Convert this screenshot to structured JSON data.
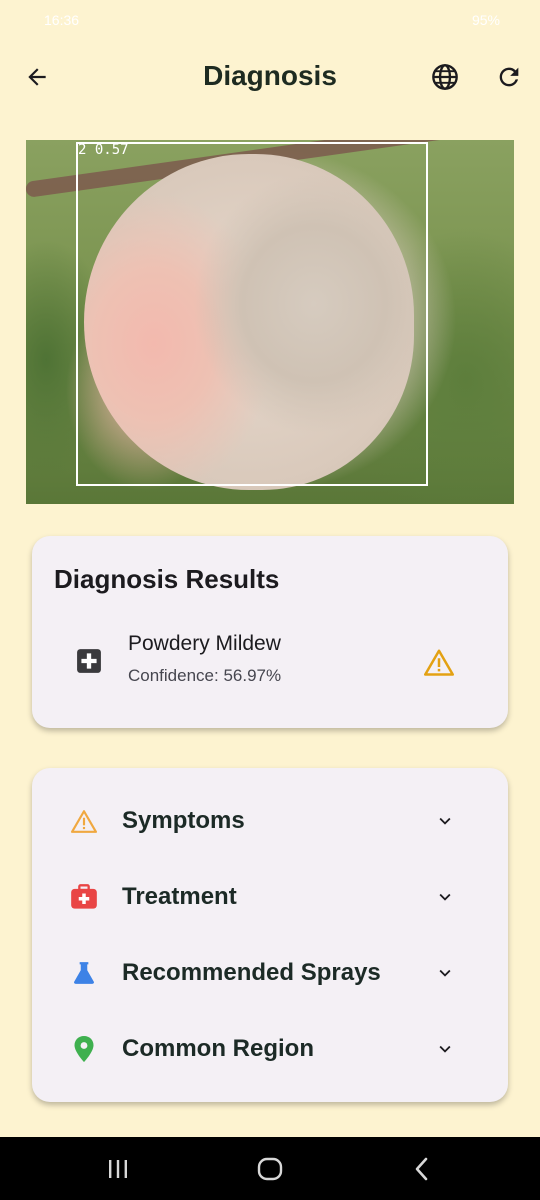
{
  "status_bar": {
    "time": "16:36",
    "battery": "95%"
  },
  "app_bar": {
    "title": "Diagnosis",
    "back_icon": "arrow-left-icon",
    "language_icon": "globe-icon",
    "refresh_icon": "refresh-icon"
  },
  "photo": {
    "detection_label": "2 0.57"
  },
  "results": {
    "title": "Diagnosis Results",
    "disease_name": "Powdery Mildew",
    "confidence": "Confidence: 56.97%",
    "confidence_value": 0.5697,
    "disease_icon": "medical-cross-icon",
    "severity_icon": "warning-icon",
    "severity_color": "#e3a113"
  },
  "info_sections": [
    {
      "label": "Symptoms",
      "icon": "warning-outline-icon",
      "color": "#f0a840"
    },
    {
      "label": "Treatment",
      "icon": "first-aid-kit-icon",
      "color": "#e94545"
    },
    {
      "label": "Recommended Sprays",
      "icon": "flask-icon",
      "color": "#3d82e6"
    },
    {
      "label": "Common Region",
      "icon": "location-pin-icon",
      "color": "#3fb04f"
    }
  ],
  "colors": {
    "background": "#fdf3d0",
    "card": "#f4f0f5",
    "title_text": "#1e2b21"
  }
}
